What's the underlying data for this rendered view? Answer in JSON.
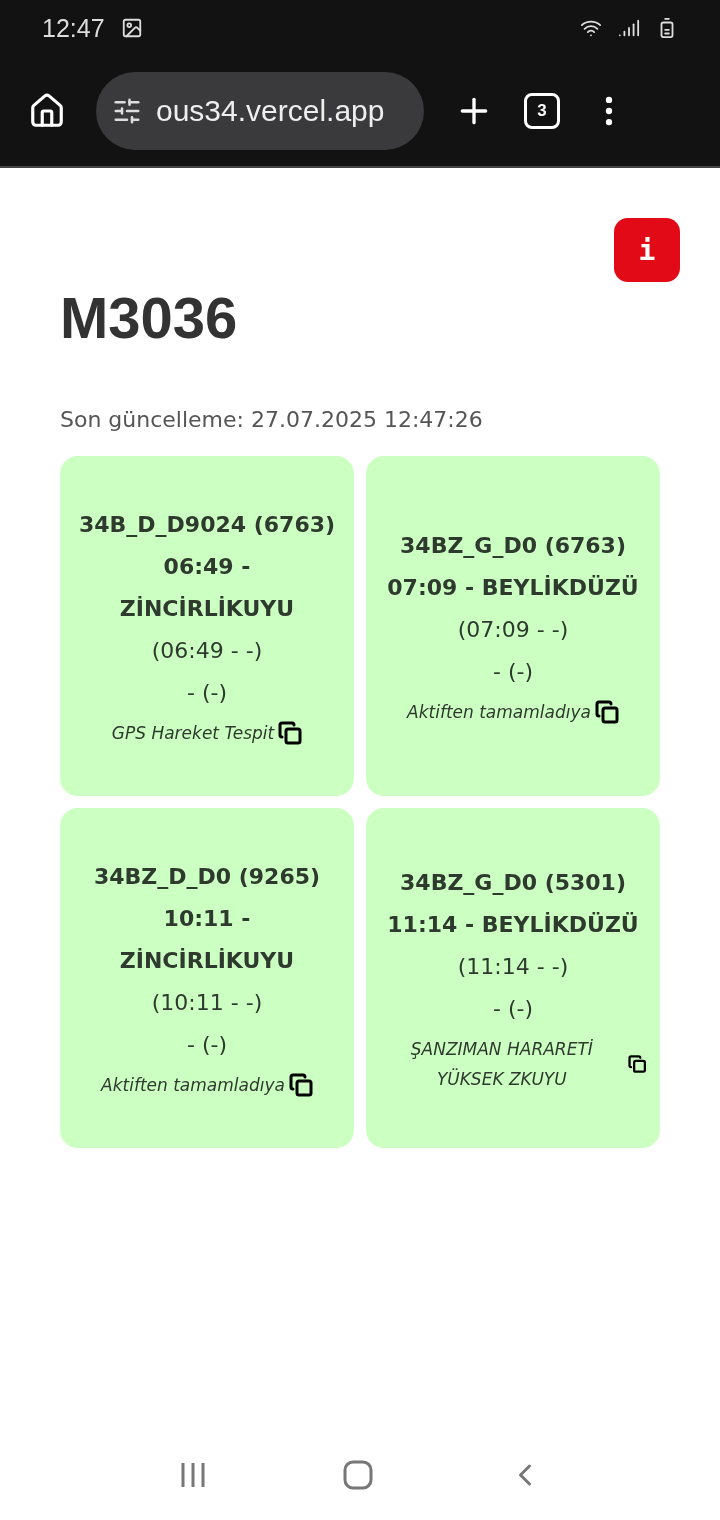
{
  "status_bar": {
    "time": "12:47"
  },
  "browser": {
    "url": "ous34.vercel.app",
    "tab_count": "3"
  },
  "info_button": {
    "label": "i"
  },
  "title": "M3036",
  "updated": "Son güncelleme: 27.07.2025 12:47:26",
  "cards": [
    {
      "lines": [
        "34B_D_D9024 (6763)",
        "06:49 - ZİNCİRLİKUYU"
      ],
      "times": "(06:49 - -)",
      "extra": "- (-)",
      "note": "GPS Hareket Tespit"
    },
    {
      "lines": [
        "34BZ_G_D0 (6763)",
        "07:09 - BEYLİKDÜZÜ"
      ],
      "times": "(07:09 - -)",
      "extra": "- (-)",
      "note": "Aktiften tamamladıya"
    },
    {
      "lines": [
        "34BZ_D_D0 (9265)",
        "10:11 - ZİNCİRLİKUYU"
      ],
      "times": "(10:11 - -)",
      "extra": "- (-)",
      "note": "Aktiften tamamladıya"
    },
    {
      "lines": [
        "34BZ_G_D0 (5301)",
        "11:14 - BEYLİKDÜZÜ"
      ],
      "times": "(11:14 - -)",
      "extra": "- (-)",
      "note": "ŞANZIMAN HARARETİ YÜKSEK ZKUYU"
    }
  ]
}
